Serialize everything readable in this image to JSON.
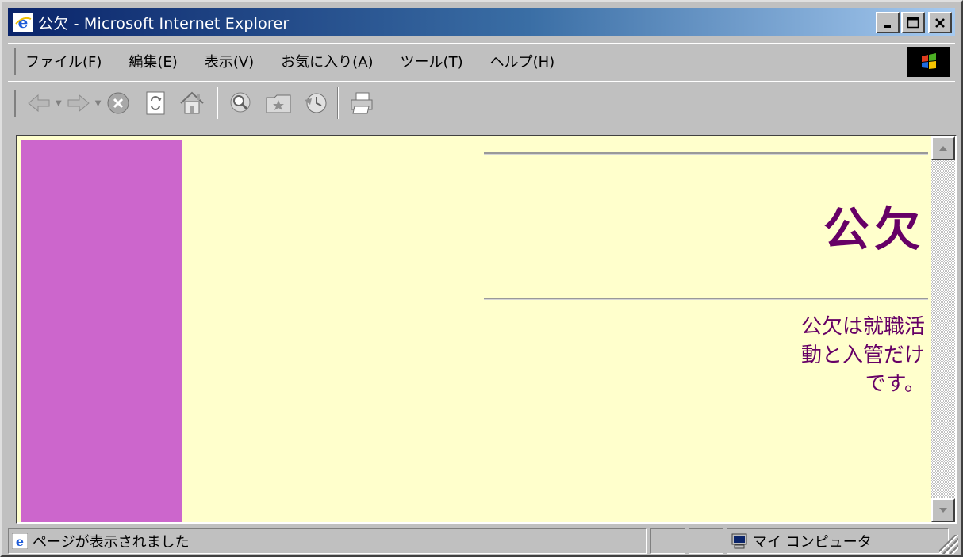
{
  "window": {
    "title": "公欠 - Microsoft Internet Explorer",
    "minimize_label": "_",
    "maximize_label": "□",
    "close_label": "×"
  },
  "menu": {
    "items": [
      {
        "label": "ファイル(F)"
      },
      {
        "label": "編集(E)"
      },
      {
        "label": "表示(V)"
      },
      {
        "label": "お気に入り(A)"
      },
      {
        "label": "ツール(T)"
      },
      {
        "label": "ヘルプ(H)"
      }
    ]
  },
  "toolbar": {
    "icons": [
      "back-icon",
      "forward-icon",
      "stop-icon",
      "refresh-icon",
      "home-icon",
      "search-icon",
      "favorites-icon",
      "history-icon",
      "print-icon"
    ]
  },
  "page": {
    "heading": "公欠",
    "body": "公欠は就職活動と入管だけです。",
    "left_band_color": "#cc66cc",
    "background_color": "#ffffcc",
    "text_color": "#660066"
  },
  "status": {
    "message": "ページが表示されました",
    "zone": "マイ コンピュータ"
  }
}
